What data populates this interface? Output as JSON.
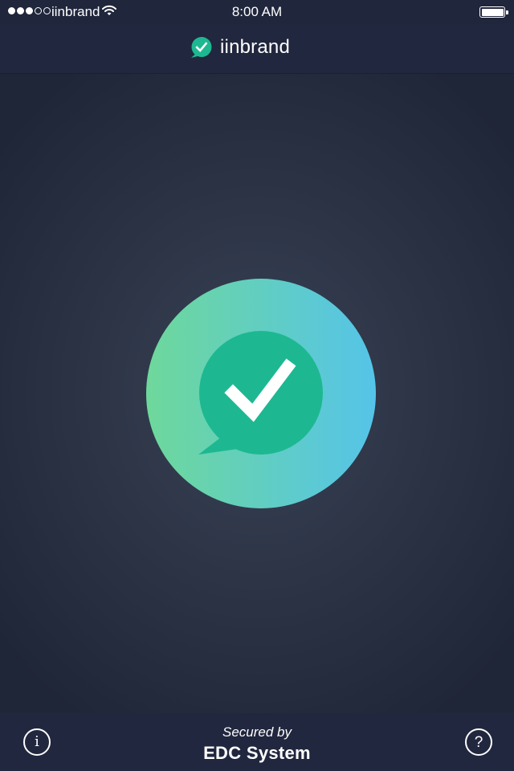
{
  "status_bar": {
    "carrier": "iinbrand",
    "time": "8:00 AM",
    "signal_bars": 3,
    "signal_max": 5,
    "battery_level": 1.0
  },
  "header": {
    "brand_name": "iinbrand",
    "brand_icon": "chat-check-icon"
  },
  "main": {
    "logo_icon": "chat-check-icon"
  },
  "footer": {
    "info_label": "i",
    "secured_by": "Secured by",
    "system_name": "EDC System",
    "help_label": "?"
  },
  "colors": {
    "accent_green": "#1db891",
    "gradient_start": "#6ed89b",
    "gradient_end": "#55c4e8",
    "bar_background": "#21273e"
  }
}
